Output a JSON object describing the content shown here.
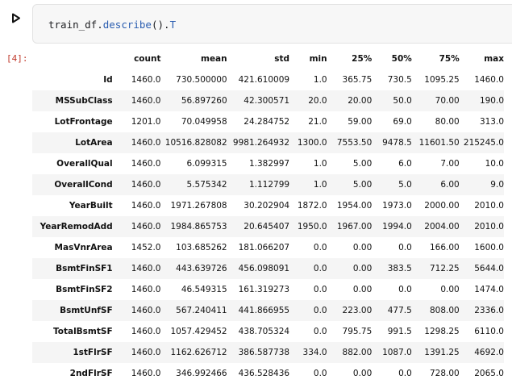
{
  "cell": {
    "code": {
      "object": "train_df",
      "method": "describe",
      "parens": "()",
      "dot": ".",
      "attr": "T"
    },
    "exec_count": "[4]:"
  },
  "table": {
    "columns": [
      "",
      "count",
      "mean",
      "std",
      "min",
      "25%",
      "50%",
      "75%",
      "max"
    ],
    "rows": [
      [
        "Id",
        "1460.0",
        "730.500000",
        "421.610009",
        "1.0",
        "365.75",
        "730.5",
        "1095.25",
        "1460.0"
      ],
      [
        "MSSubClass",
        "1460.0",
        "56.897260",
        "42.300571",
        "20.0",
        "20.00",
        "50.0",
        "70.00",
        "190.0"
      ],
      [
        "LotFrontage",
        "1201.0",
        "70.049958",
        "24.284752",
        "21.0",
        "59.00",
        "69.0",
        "80.00",
        "313.0"
      ],
      [
        "LotArea",
        "1460.0",
        "10516.828082",
        "9981.264932",
        "1300.0",
        "7553.50",
        "9478.5",
        "11601.50",
        "215245.0"
      ],
      [
        "OverallQual",
        "1460.0",
        "6.099315",
        "1.382997",
        "1.0",
        "5.00",
        "6.0",
        "7.00",
        "10.0"
      ],
      [
        "OverallCond",
        "1460.0",
        "5.575342",
        "1.112799",
        "1.0",
        "5.00",
        "5.0",
        "6.00",
        "9.0"
      ],
      [
        "YearBuilt",
        "1460.0",
        "1971.267808",
        "30.202904",
        "1872.0",
        "1954.00",
        "1973.0",
        "2000.00",
        "2010.0"
      ],
      [
        "YearRemodAdd",
        "1460.0",
        "1984.865753",
        "20.645407",
        "1950.0",
        "1967.00",
        "1994.0",
        "2004.00",
        "2010.0"
      ],
      [
        "MasVnrArea",
        "1452.0",
        "103.685262",
        "181.066207",
        "0.0",
        "0.00",
        "0.0",
        "166.00",
        "1600.0"
      ],
      [
        "BsmtFinSF1",
        "1460.0",
        "443.639726",
        "456.098091",
        "0.0",
        "0.00",
        "383.5",
        "712.25",
        "5644.0"
      ],
      [
        "BsmtFinSF2",
        "1460.0",
        "46.549315",
        "161.319273",
        "0.0",
        "0.00",
        "0.0",
        "0.00",
        "1474.0"
      ],
      [
        "BsmtUnfSF",
        "1460.0",
        "567.240411",
        "441.866955",
        "0.0",
        "223.00",
        "477.5",
        "808.00",
        "2336.0"
      ],
      [
        "TotalBsmtSF",
        "1460.0",
        "1057.429452",
        "438.705324",
        "0.0",
        "795.75",
        "991.5",
        "1298.25",
        "6110.0"
      ],
      [
        "1stFlrSF",
        "1460.0",
        "1162.626712",
        "386.587738",
        "334.0",
        "882.00",
        "1087.0",
        "1391.25",
        "4692.0"
      ],
      [
        "2ndFlrSF",
        "1460.0",
        "346.992466",
        "436.528436",
        "0.0",
        "0.00",
        "0.0",
        "728.00",
        "2065.0"
      ]
    ]
  }
}
